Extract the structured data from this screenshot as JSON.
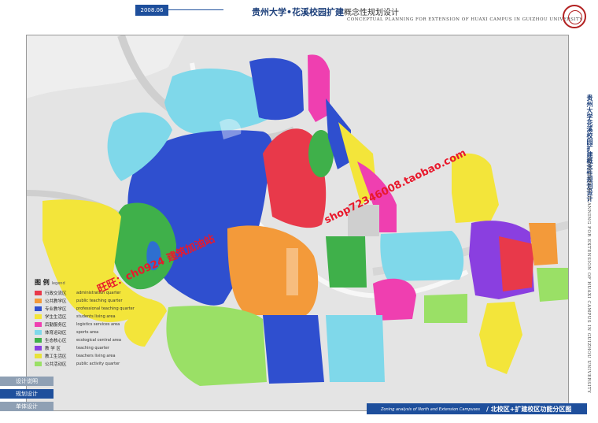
{
  "header": {
    "date": "2008.06",
    "title_main": "贵州大学•花溪校园扩建",
    "title_sub": "概念性规划设计",
    "subtitle_en": "CONCEPTUAL PLANNING FOR EXTENSION OF HUAXI CAMPUS IN GUIZHOU UNIVERSITY"
  },
  "side": {
    "title_cn": "贵州大学花溪校园扩建概念性规划设计",
    "title_en": "CONCEPTUAL PLANNING FOR EXTENSION OF HUAXI CAMPUS IN GUIZHOU UNIVERSITY"
  },
  "nav": {
    "item1": "设计说明",
    "item2": "规划设计",
    "item3": "单体设计"
  },
  "footer": {
    "en": "Zoning analysis of North and Extension Campuses",
    "cn": "/ 北校区+扩建校区功能分区图"
  },
  "legend": {
    "title_cn": "图 例",
    "title_en": "legend",
    "items": [
      {
        "cn": "行政交流区",
        "en": "administration quarter",
        "color": "#e8394a"
      },
      {
        "cn": "公共教学区",
        "en": "public teaching quarter",
        "color": "#f39a3a"
      },
      {
        "cn": "专业教学区",
        "en": "professional teaching quarter",
        "color": "#2f4fcf"
      },
      {
        "cn": "学生生活区",
        "en": "students living area",
        "color": "#f3e53a"
      },
      {
        "cn": "后勤服务区",
        "en": "logistics services area",
        "color": "#ef3fb0"
      },
      {
        "cn": "体育运动区",
        "en": "sports area",
        "color": "#7fd8ea"
      },
      {
        "cn": "生态核心区",
        "en": "ecological central area",
        "color": "#3fb04a"
      },
      {
        "cn": "教 学 区",
        "en": "teaching quarter",
        "color": "#8a3fe0"
      },
      {
        "cn": "教工生活区",
        "en": "teachers living area",
        "color": "#e8e23a"
      },
      {
        "cn": "公共活动区",
        "en": "public activity quarter",
        "color": "#9ae066"
      }
    ]
  },
  "watermarks": {
    "line1": "旺旺：ch0924  建筑加油站",
    "line2": "shop72346008.taobao.com"
  }
}
